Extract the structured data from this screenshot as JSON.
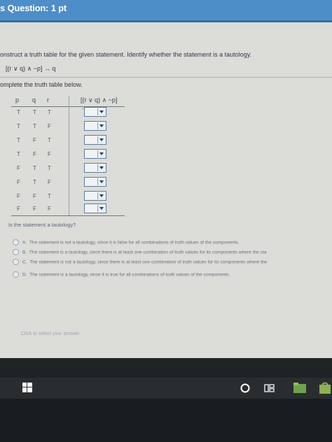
{
  "header": {
    "title": "s Question: 1 pt"
  },
  "question": {
    "instruction": "onstruct a truth table for the given statement. Identify whether the statement is a tautology.",
    "statement": "[(r ∨ q) ∧ ~p] → q",
    "complete_label": "omplete the truth table below."
  },
  "table": {
    "headers": [
      "p",
      "q",
      "r",
      "[(r ∨ q) ∧ ~p] → q"
    ],
    "rows": [
      [
        "T",
        "T",
        "T"
      ],
      [
        "T",
        "T",
        "F"
      ],
      [
        "T",
        "F",
        "T"
      ],
      [
        "T",
        "F",
        "F"
      ],
      [
        "F",
        "T",
        "T"
      ],
      [
        "F",
        "T",
        "F"
      ],
      [
        "F",
        "F",
        "T"
      ],
      [
        "F",
        "F",
        "F"
      ]
    ]
  },
  "tautology": {
    "question": "Is the statement a tautology?",
    "options": [
      {
        "letter": "A.",
        "text": "The statement is not a tautology, since it is false for all combinations of truth values of the components."
      },
      {
        "letter": "B.",
        "text": "The statement is a tautology, since there is at least one combination of truth values for its components where the sta"
      },
      {
        "letter": "C.",
        "text": "The statement is not a tautology, since there is at least one combination of truth values for its components where the"
      },
      {
        "letter": "D.",
        "text": "The statement is a tautology, since it is true for all combinations of truth values of the components."
      }
    ]
  },
  "footer": {
    "hint": "Click to select your answer."
  }
}
